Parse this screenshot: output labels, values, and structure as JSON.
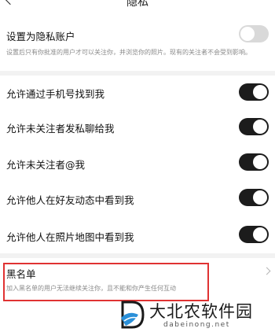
{
  "header": {
    "title": "隐私"
  },
  "private_account": {
    "label": "设置为隐私账户",
    "description": "设置后只有你批准的用户才可以关注你，并浏览你的照片。现有的关注者不会受到影响。",
    "toggle_on": false
  },
  "settings": [
    {
      "label": "允许通过手机号找到我",
      "toggle_on": true
    },
    {
      "label": "允许未关注者发私聊给我",
      "toggle_on": true
    },
    {
      "label": "允许未关注者@我",
      "toggle_on": true
    },
    {
      "label": "允许他人在好友动态中看到我",
      "toggle_on": true
    },
    {
      "label": "允许他人在照片地图中看到我",
      "toggle_on": true
    }
  ],
  "blacklist": {
    "label": "黑名单",
    "description": "加入黑名单的用户无法继续关注你，且不能和你产生任何互动"
  },
  "watermark": {
    "title": "大北农软件园",
    "subtitle": "dabeinong.net"
  },
  "colors": {
    "toggle_on": "#1c1c1c",
    "toggle_off": "#d9d9d9",
    "highlight_box": "#e03232"
  }
}
